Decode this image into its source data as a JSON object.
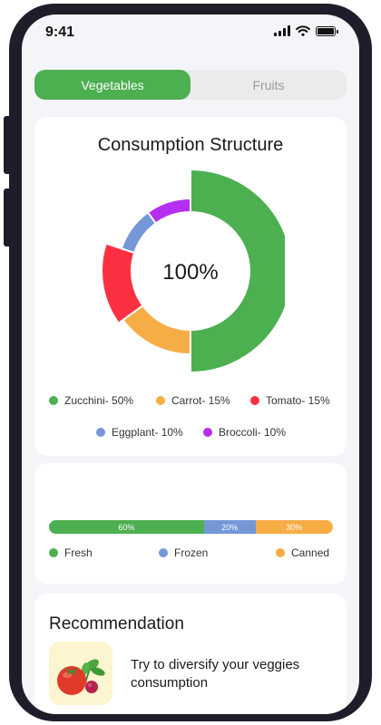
{
  "status_bar": {
    "time": "9:41"
  },
  "tabs": [
    {
      "label": "Vegetables",
      "active": true
    },
    {
      "label": "Fruits",
      "active": false
    }
  ],
  "consumption_card": {
    "title": "Consumption Structure",
    "center_label": "100%",
    "legend": [
      {
        "label": "Zucchini- 50%"
      },
      {
        "label": "Carrot- 15%"
      },
      {
        "label": "Tomato- 15%"
      },
      {
        "label": "Eggplant- 10%"
      },
      {
        "label": "Broccoli- 10%"
      }
    ]
  },
  "storage_card": {
    "segments": [
      {
        "label": "60%"
      },
      {
        "label": "20%"
      },
      {
        "label": "30%"
      }
    ],
    "legend": [
      {
        "label": "Fresh"
      },
      {
        "label": "Frozen"
      },
      {
        "label": "Canned"
      }
    ]
  },
  "recommendation": {
    "title": "Recommendation",
    "text": "Try to diversify your veggies consumption"
  },
  "colors": {
    "primary": "#4caf50",
    "zucchini": "#4caf50",
    "carrot": "#f6ad46",
    "tomato": "#fb3142",
    "eggplant": "#7497d7",
    "broccoli": "#b42ff2"
  },
  "chart_data": [
    {
      "type": "pie",
      "categories": [
        "Zucchini",
        "Carrot",
        "Tomato",
        "Eggplant",
        "Broccoli"
      ],
      "values": [
        50,
        15,
        15,
        10,
        10
      ]
    },
    {
      "type": "bar",
      "categories": [
        "Fresh",
        "Frozen",
        "Canned"
      ],
      "values": [
        60,
        20,
        30
      ]
    }
  ]
}
